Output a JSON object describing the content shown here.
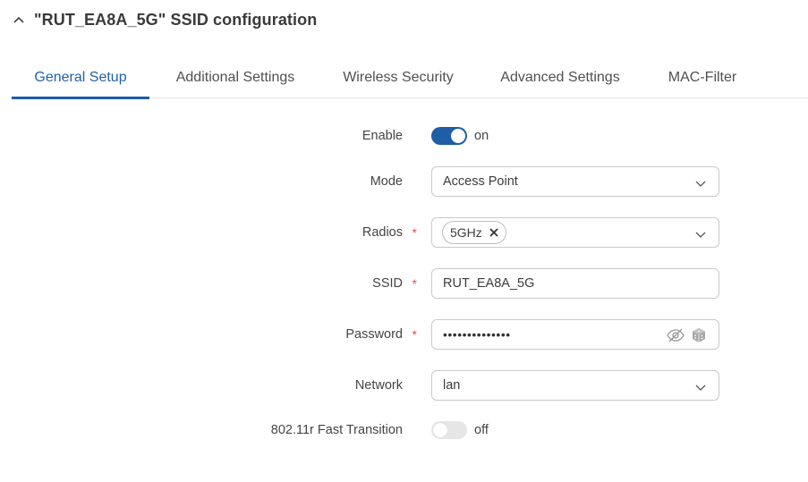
{
  "section": {
    "title": "\"RUT_EA8A_5G\" SSID configuration",
    "chevron_icon": "chevron-up-icon"
  },
  "tabs": [
    {
      "label": "General Setup",
      "active": true
    },
    {
      "label": "Additional Settings",
      "active": false
    },
    {
      "label": "Wireless Security",
      "active": false
    },
    {
      "label": "Advanced Settings",
      "active": false
    },
    {
      "label": "MAC-Filter",
      "active": false
    }
  ],
  "form": {
    "enable": {
      "label": "Enable",
      "state_text": "on",
      "checked": true
    },
    "mode": {
      "label": "Mode",
      "value": "Access Point"
    },
    "radios": {
      "label": "Radios",
      "required_mark": "*",
      "chip": "5GHz"
    },
    "ssid": {
      "label": "SSID",
      "required_mark": "*",
      "value": "RUT_EA8A_5G"
    },
    "password": {
      "label": "Password",
      "required_mark": "*",
      "masked_value": "••••••••••••••",
      "toggle_icon": "eye-slash-icon",
      "generate_icon": "dice-icon"
    },
    "network": {
      "label": "Network",
      "value": "lan"
    },
    "fast_transition": {
      "label": "802.11r Fast Transition",
      "state_text": "off",
      "checked": false
    }
  },
  "colors": {
    "accent": "#1d5ea6",
    "active_tab_text": "#2161a8",
    "required": "#d9534f"
  }
}
